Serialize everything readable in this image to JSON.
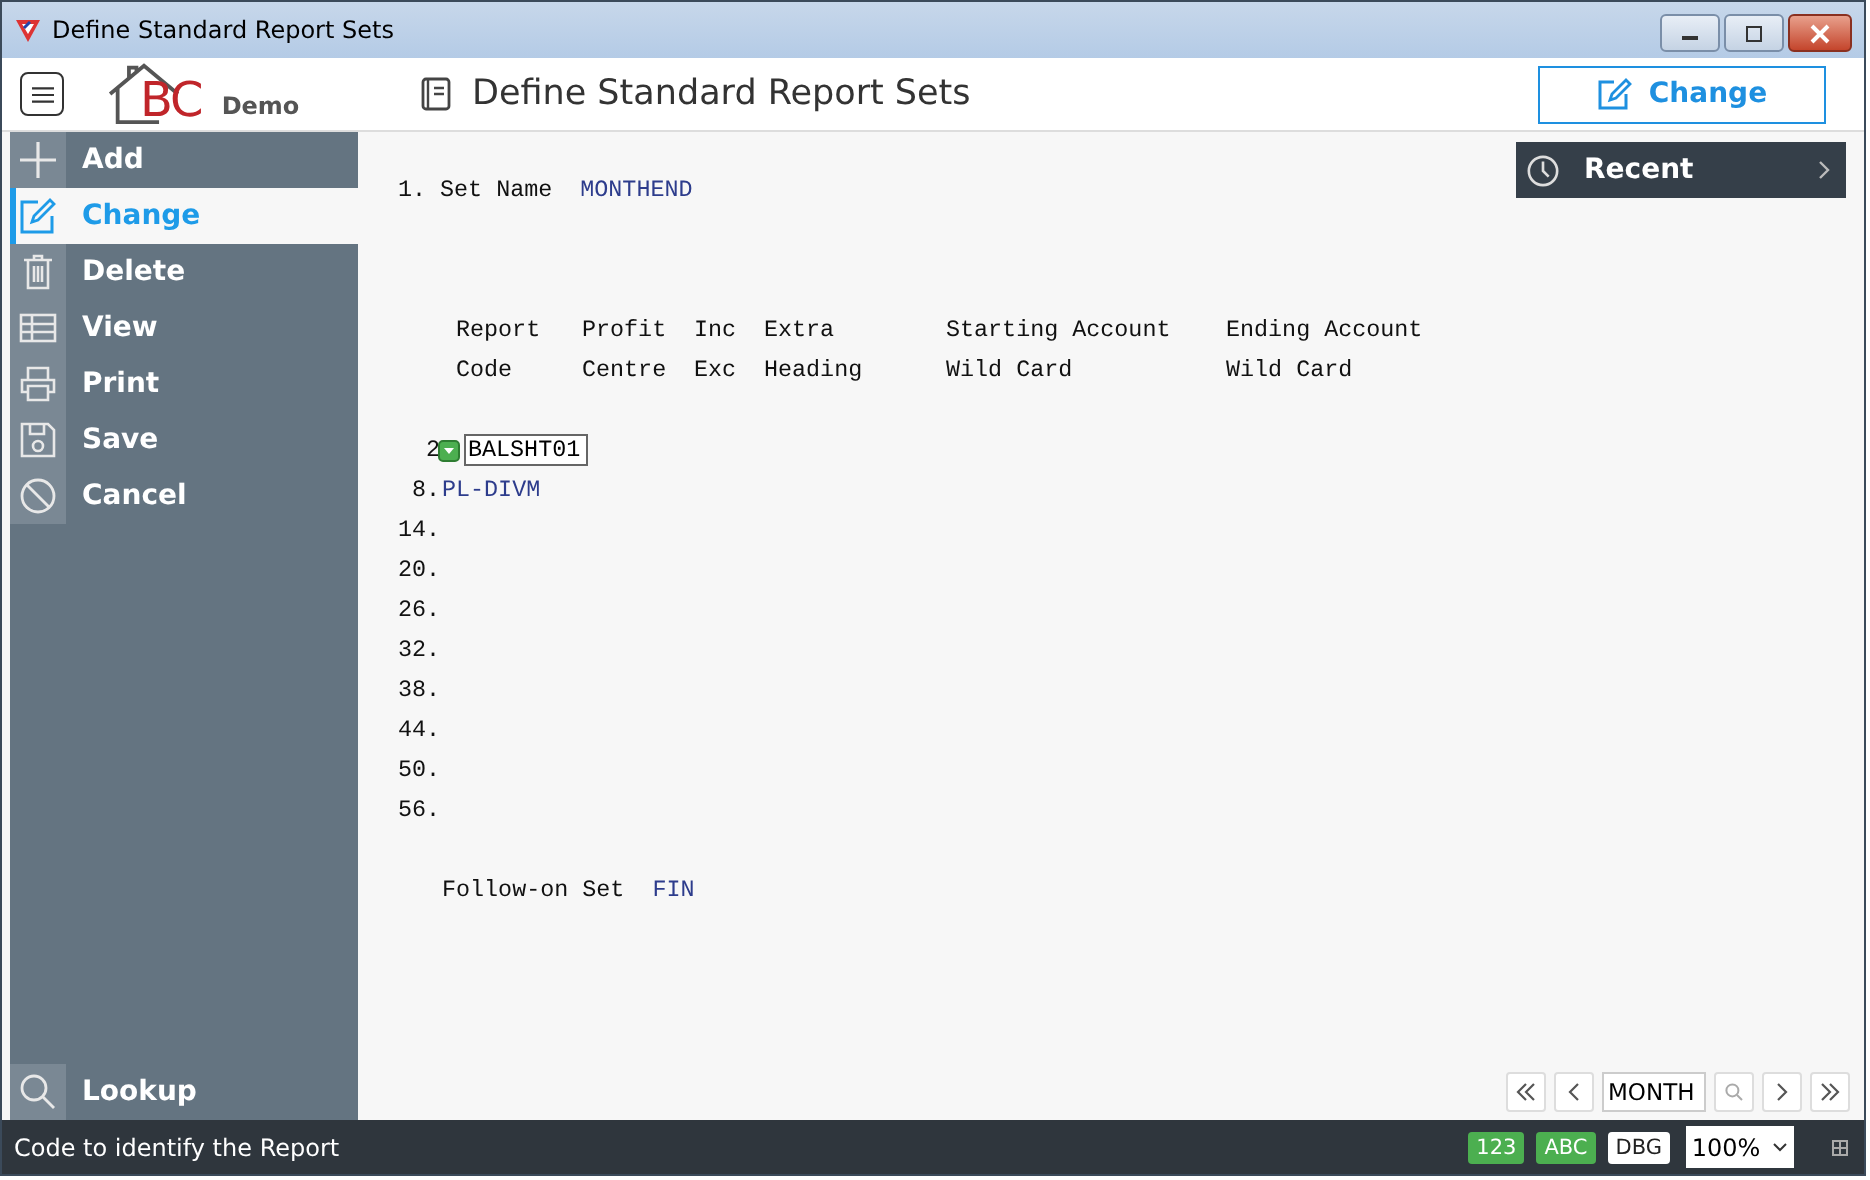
{
  "window": {
    "title": "Define Standard Report Sets"
  },
  "header": {
    "logo_letters": "BC",
    "logo_caption": "Demo",
    "page_title": "Define Standard Report Sets",
    "action_button": "Change"
  },
  "sidebar": {
    "items": [
      {
        "label": "Add",
        "selected": false
      },
      {
        "label": "Change",
        "selected": true
      },
      {
        "label": "Delete",
        "selected": false
      },
      {
        "label": "View",
        "selected": false
      },
      {
        "label": "Print",
        "selected": false
      },
      {
        "label": "Save",
        "selected": false
      },
      {
        "label": "Cancel",
        "selected": false
      }
    ],
    "lookup": "Lookup"
  },
  "recent": {
    "label": "Recent"
  },
  "form": {
    "set_name": {
      "number": "1.",
      "label": "Set Name",
      "value": "MONTHEND"
    },
    "columns": [
      {
        "line1": "Report",
        "line2": "Code"
      },
      {
        "line1": "Profit",
        "line2": "Centre"
      },
      {
        "line1": "Inc",
        "line2": "Exc"
      },
      {
        "line1": "Extra",
        "line2": "Heading"
      },
      {
        "line1": "Starting Account",
        "line2": "Wild Card"
      },
      {
        "line1": "Ending Account",
        "line2": "Wild Card"
      }
    ],
    "rows": [
      {
        "number": "2",
        "kind": "active",
        "value": "BALSHT01"
      },
      {
        "number": "8.",
        "kind": "value",
        "value": "PL-DIVM"
      },
      {
        "number": "14.",
        "kind": "empty"
      },
      {
        "number": "20.",
        "kind": "empty"
      },
      {
        "number": "26.",
        "kind": "empty"
      },
      {
        "number": "32.",
        "kind": "empty"
      },
      {
        "number": "38.",
        "kind": "empty"
      },
      {
        "number": "44.",
        "kind": "empty"
      },
      {
        "number": "50.",
        "kind": "empty"
      },
      {
        "number": "56.",
        "kind": "empty"
      }
    ],
    "follow_on": {
      "label": "Follow-on Set",
      "value": "FIN"
    }
  },
  "navigator": {
    "field": "MONTH"
  },
  "status_bar": {
    "message": "Code to identify the Report",
    "badges": [
      {
        "label": "123",
        "on": true
      },
      {
        "label": "ABC",
        "on": true
      },
      {
        "label": "DBG",
        "on": false
      }
    ],
    "zoom": "100%"
  }
}
